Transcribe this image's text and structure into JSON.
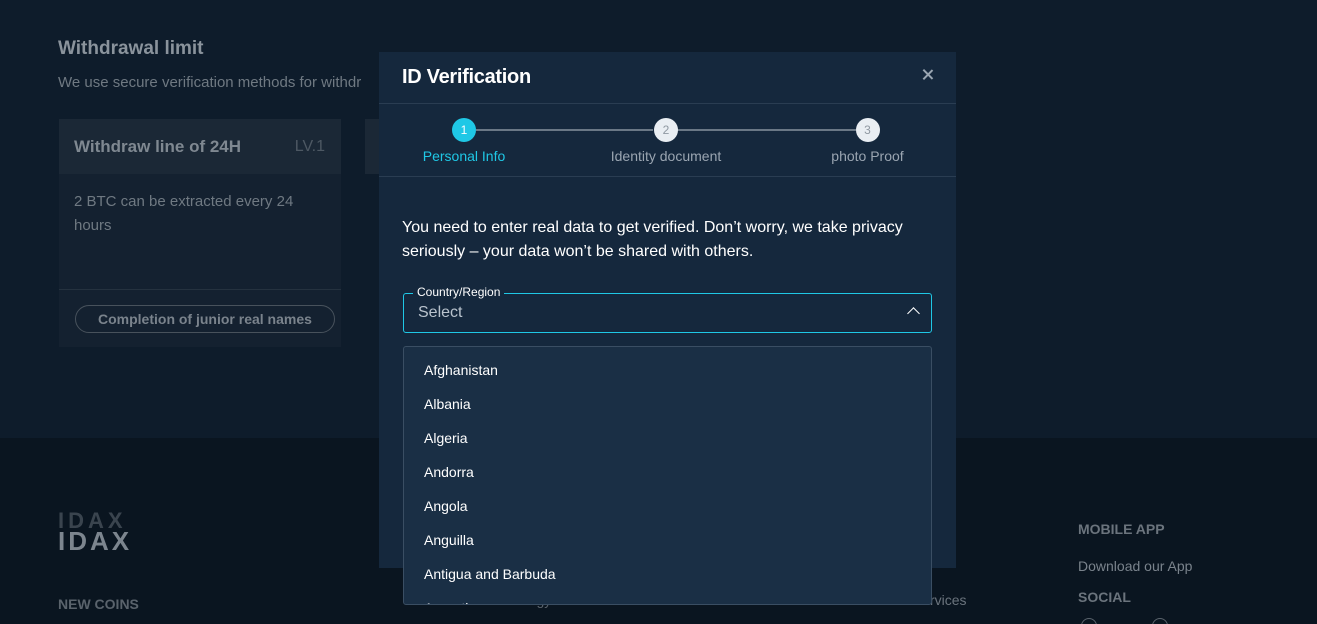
{
  "background": {
    "withdrawal_title": "Withdrawal limit",
    "withdrawal_sub": "We use secure verification methods for withdr",
    "card": {
      "title": "Withdraw line of 24H",
      "level": "LV.1",
      "body": "2 BTC can be extracted every 24 hours",
      "button": "Completion of junior real names"
    },
    "logo_text": "IDAX",
    "footer": {
      "new_coins": "NEW COINS",
      "mid_text": "nology",
      "right_text": "rvices",
      "mobile_app": "MOBILE APP",
      "download": "Download our App",
      "social": "SOCIAL"
    }
  },
  "modal": {
    "title": "ID Verification",
    "steps": [
      {
        "number": "1",
        "label": "Personal Info"
      },
      {
        "number": "2",
        "label": "Identity document"
      },
      {
        "number": "3",
        "label": "photo Proof"
      }
    ],
    "intro": "You need to enter real data to get verified. Don’t worry, we take privacy seriously – your data won’t be shared with others.",
    "country_field": {
      "label": "Country/Region",
      "placeholder": "Select"
    },
    "country_options": [
      "Afghanistan",
      "Albania",
      "Algeria",
      "Andorra",
      "Angola",
      "Anguilla",
      "Antigua and Barbuda",
      "Argentina"
    ]
  },
  "colors": {
    "accent": "#1fc8e6",
    "modal_bg": "#15283d",
    "page_bg": "#0e1c2b"
  }
}
